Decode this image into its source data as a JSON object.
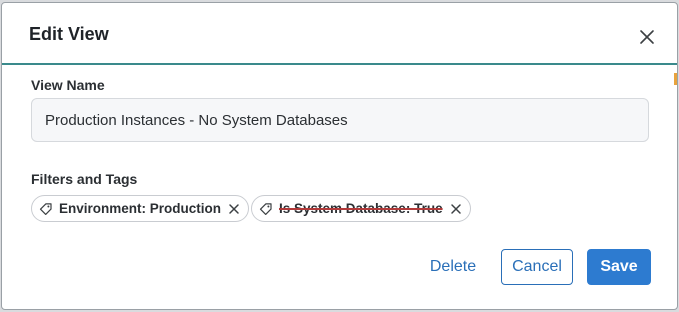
{
  "dialog": {
    "title": "Edit View",
    "close_icon": "close-icon"
  },
  "view_name": {
    "label": "View Name",
    "value": "Production Instances - No System Databases"
  },
  "filters": {
    "label": "Filters and Tags",
    "chips": [
      {
        "text": "Environment: Production",
        "icon": "tag-icon",
        "struck": false
      },
      {
        "text": "Is System Database: True",
        "icon": "tag-icon",
        "struck": true
      }
    ]
  },
  "actions": {
    "delete_label": "Delete",
    "cancel_label": "Cancel",
    "save_label": "Save"
  },
  "colors": {
    "accent": "#2d7bd0",
    "link": "#2a6fb8",
    "header_rule": "#3a8a8c",
    "strike": "#b23a3a"
  }
}
